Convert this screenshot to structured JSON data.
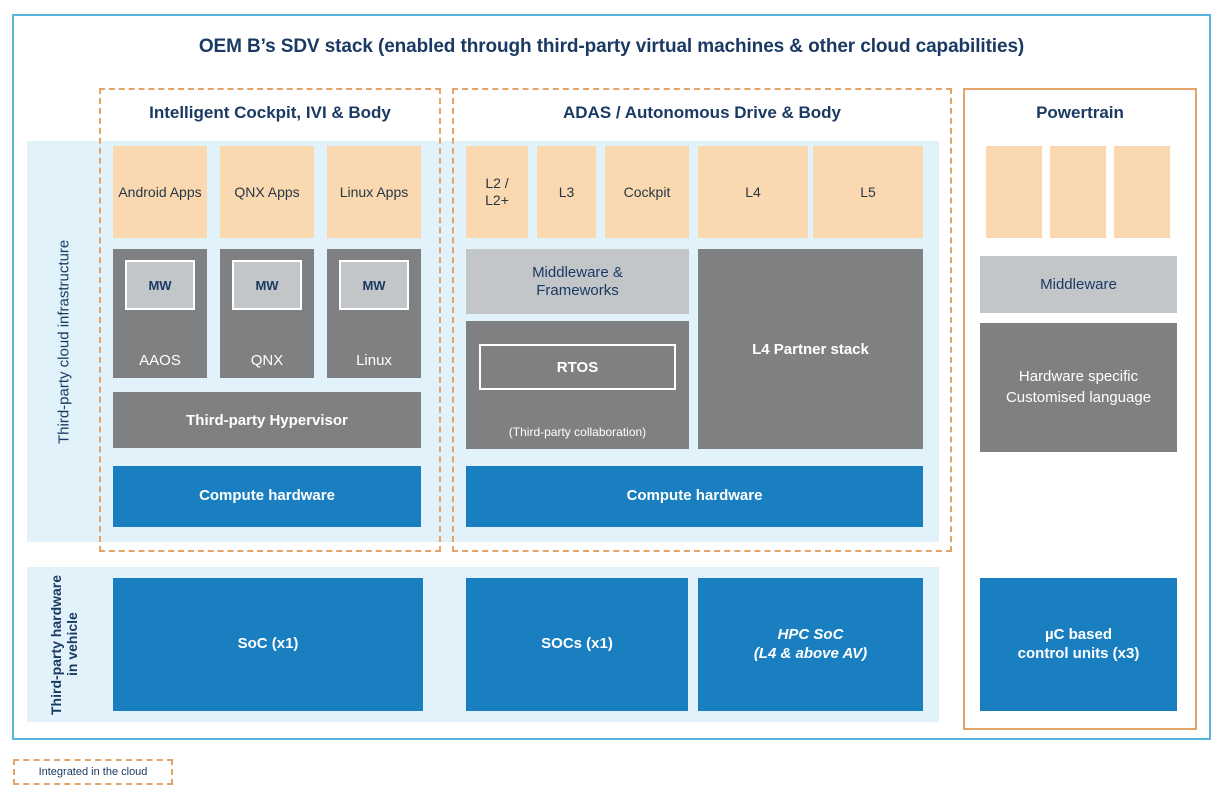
{
  "title": "OEM B’s SDV stack (enabled through third-party virtual machines & other cloud capabilities)",
  "side_labels": {
    "cloud": "Third-party cloud infrastructure",
    "hardware": "Third-party hardware\nin vehicle"
  },
  "columns": {
    "cockpit": {
      "title": "Intelligent Cockpit, IVI & Body",
      "apps": [
        "Android Apps",
        "QNX Apps",
        "Linux Apps"
      ],
      "os_stacks": [
        {
          "mw": "MW",
          "name": "AAOS"
        },
        {
          "mw": "MW",
          "name": "QNX"
        },
        {
          "mw": "MW",
          "name": "Linux"
        }
      ],
      "hypervisor": "Third-party Hypervisor",
      "compute": "Compute hardware",
      "soc": "SoC (x1)"
    },
    "adas": {
      "title": "ADAS / Autonomous Drive & Body",
      "apps": [
        "L2 /\nL2+",
        "L3",
        "Cockpit",
        "L4",
        "L5"
      ],
      "middleware": "Middleware &\nFrameworks",
      "rtos": "RTOS",
      "rtos_note": "(Third-party collaboration)",
      "partner_stack": "L4 Partner stack",
      "compute": "Compute hardware",
      "soc_left": "SOCs (x1)",
      "soc_right_line1": "HPC SoC",
      "soc_right_line2": "(L4 & above AV)"
    },
    "powertrain": {
      "title": "Powertrain",
      "apps": [
        "",
        "",
        ""
      ],
      "middleware": "Middleware",
      "hardware_layer": "Hardware specific\nCustomised language",
      "control_units": "µC based\ncontrol units (x3)"
    }
  },
  "legend": {
    "label": "Integrated in the cloud"
  },
  "colors": {
    "frame_blue": "#58b4dd",
    "panel_blue": "#e2f2fb",
    "peach": "#fbd9b0",
    "orange_dash": "#e2a46a",
    "gray_dark": "#7e8082",
    "gray_light": "#c3c6c8",
    "blue": "#1a7fc1",
    "navy_text": "#1b3a63"
  }
}
